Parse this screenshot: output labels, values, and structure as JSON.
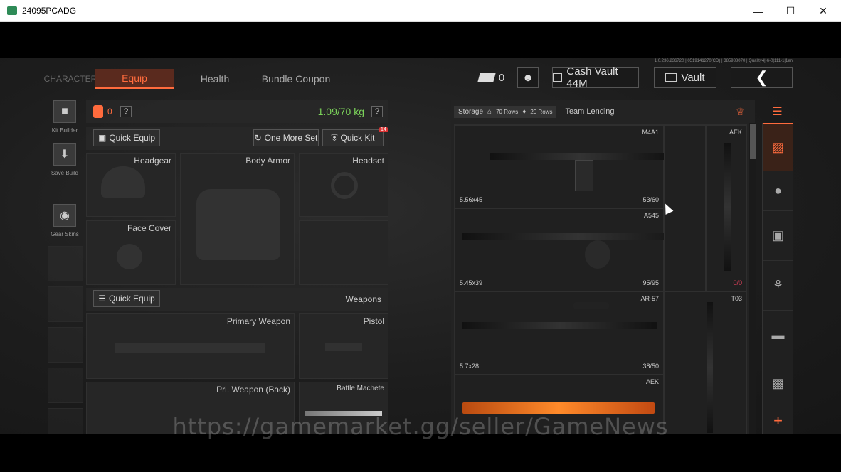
{
  "window": {
    "title": "24095PCADG"
  },
  "build_info": "1.0.236.236720 | 0519141270(CD) | 385988070 | Quality4|-6-0|111-1|1en",
  "tabs": [
    {
      "label": "CHARACTER"
    },
    {
      "label": "Equip"
    },
    {
      "label": "Health"
    },
    {
      "label": "Bundle Coupon"
    }
  ],
  "top": {
    "currency_count": "0",
    "cash_vault": "Cash Vault 44M",
    "vault": "Vault"
  },
  "left_sidebar": [
    {
      "label": "Kit Builder"
    },
    {
      "label": "Save Build"
    },
    {
      "label": "Gear Skins"
    }
  ],
  "equip": {
    "count": "0",
    "weight": "1.09/70 kg",
    "quick_equip": "Quick Equip",
    "one_more_set": "One More Set",
    "quick_kit": "Quick Kit",
    "quick_kit_badge": "14",
    "slots": {
      "headgear": "Headgear",
      "body_armor": "Body Armor",
      "headset": "Headset",
      "face_cover": "Face Cover"
    },
    "weapons_label": "Weapons",
    "weapons_quick_equip": "Quick Equip",
    "weapon_slots": {
      "primary": "Primary Weapon",
      "pistol": "Pistol",
      "pri_back": "Pri. Weapon (Back)",
      "melee": "Battle Machete"
    }
  },
  "storage": {
    "tab_storage": "Storage",
    "rows_a": "70 Rows",
    "rows_b": "20 Rows",
    "tab_team": "Team Lending",
    "items": [
      {
        "name": "M4A1",
        "ammo": "5.56x45",
        "capacity": "53/60"
      },
      {
        "name": "A545",
        "ammo": "5.45x39",
        "capacity": "95/95"
      },
      {
        "name": "AR-57",
        "ammo": "5.7x28",
        "capacity": "38/50"
      },
      {
        "name": "AEK",
        "ammo": "",
        "capacity": ""
      },
      {
        "name": "AEK",
        "ammo": "",
        "capacity": "0/0"
      },
      {
        "name": "T03",
        "ammo": "",
        "capacity": ""
      }
    ]
  },
  "watermark": "https://gamemarket.gg/seller/GameNews",
  "colors": {
    "accent": "#ff6b3d",
    "weight": "#7bd35a",
    "alert": "#e0405a"
  }
}
